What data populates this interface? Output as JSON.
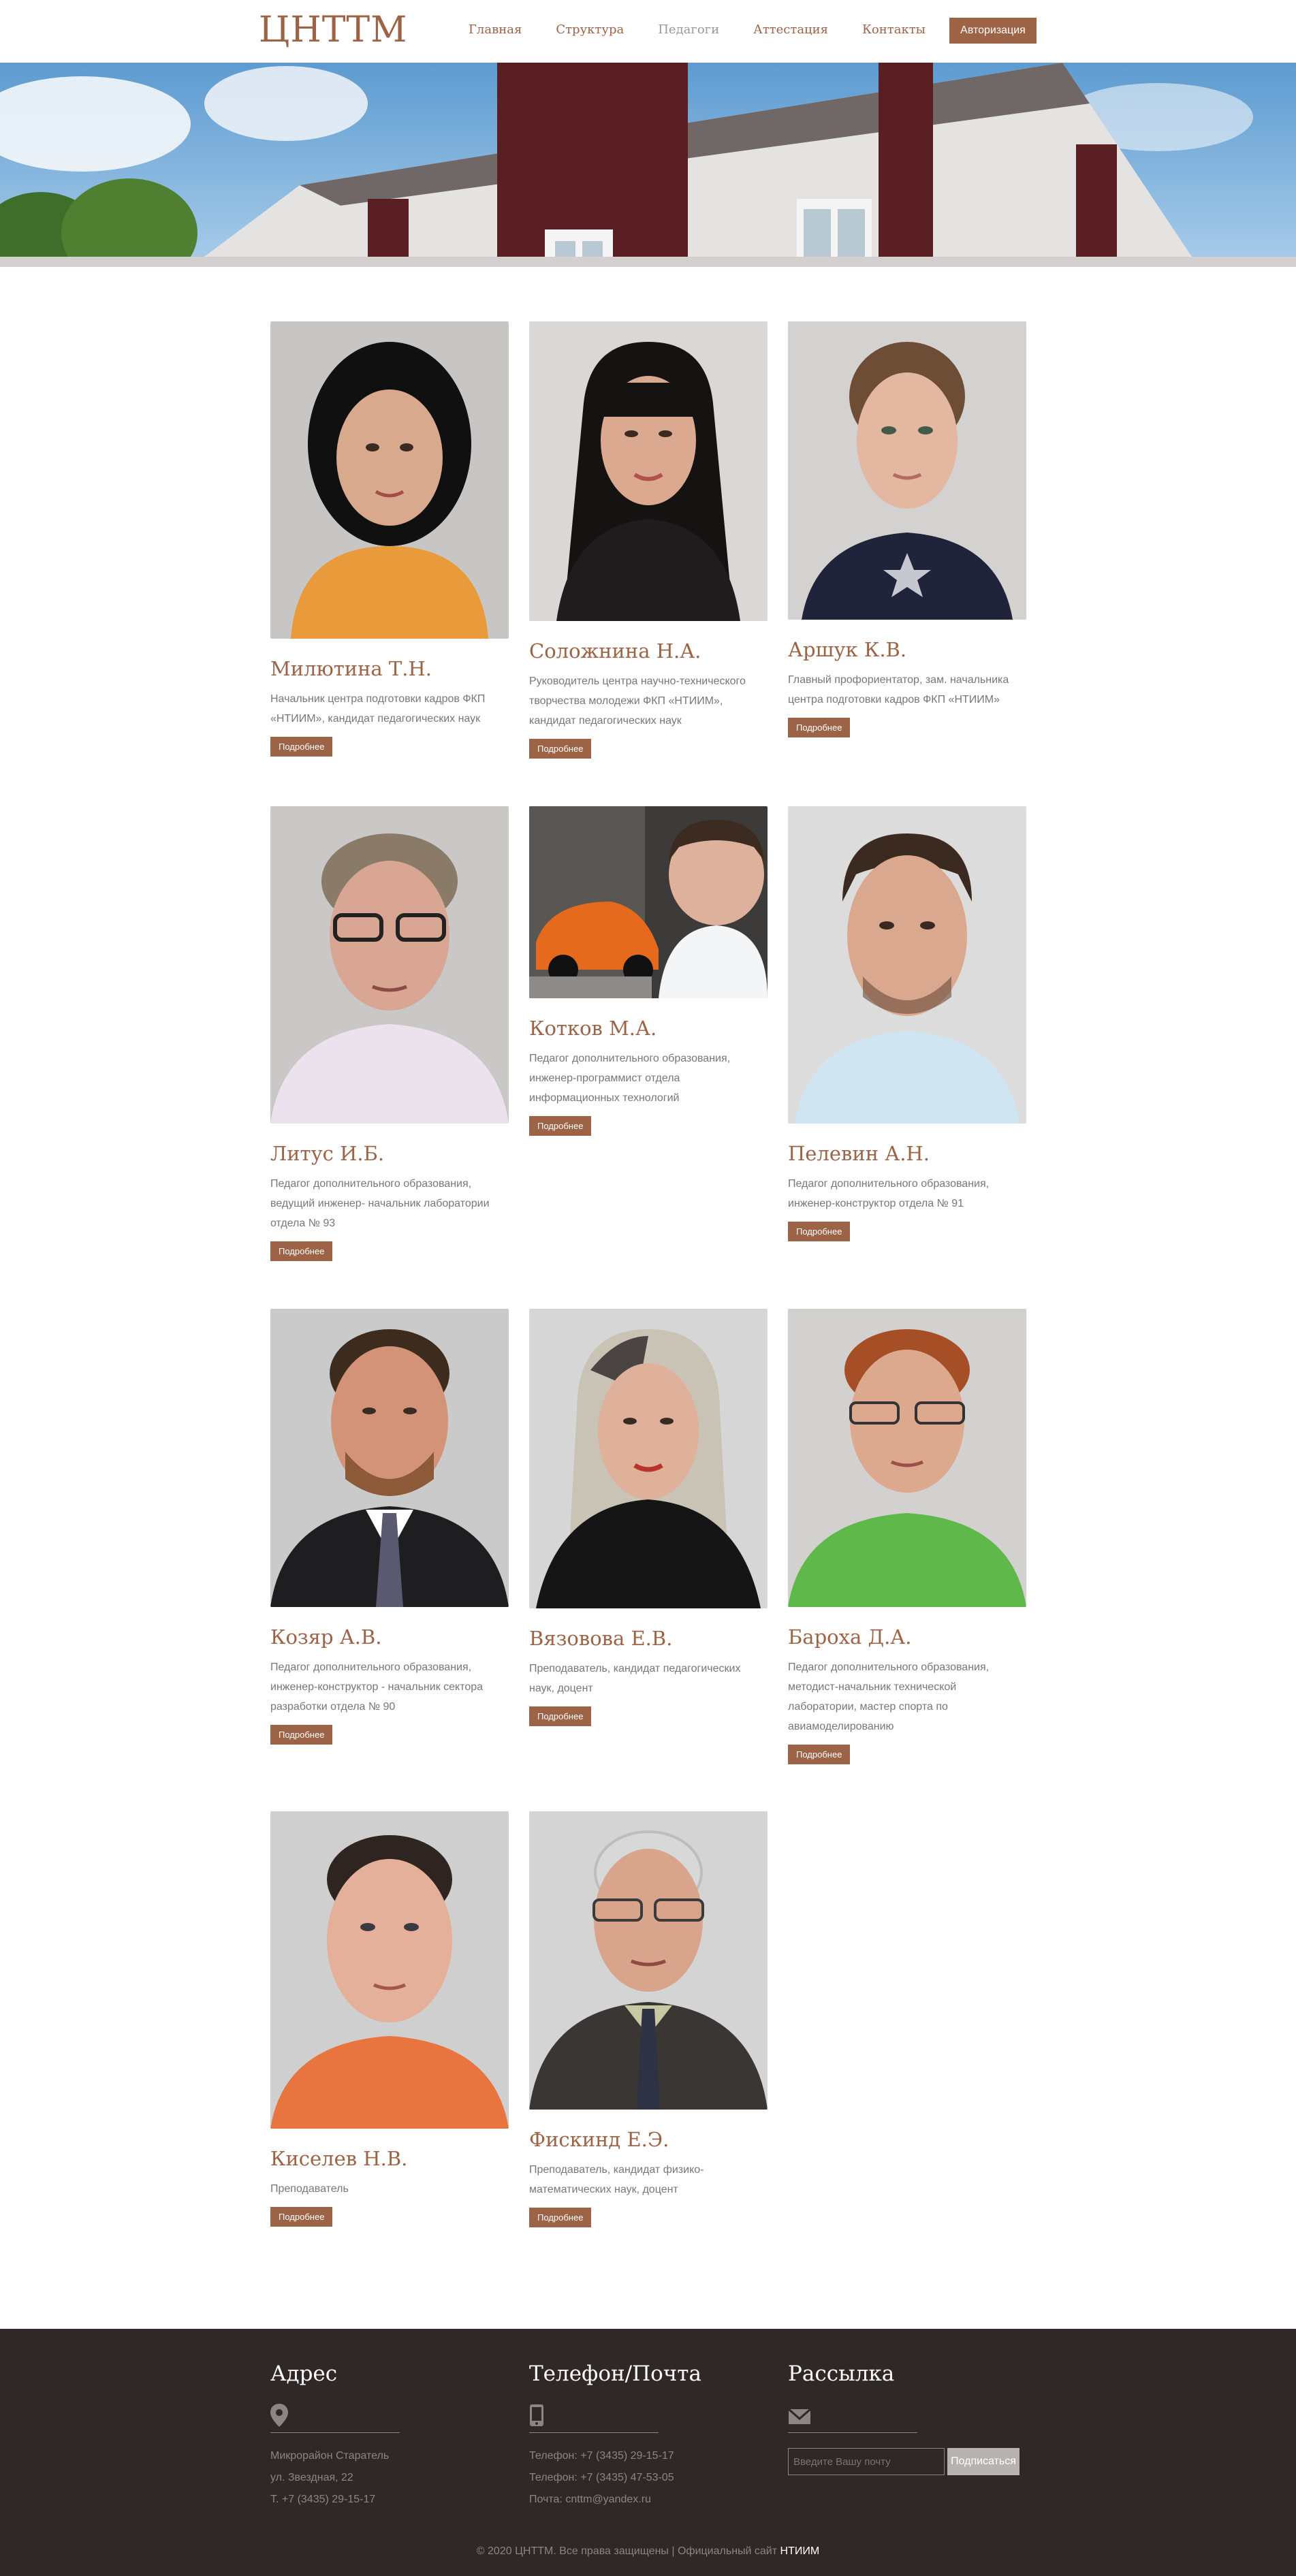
{
  "header": {
    "logo": "ЦНТТМ",
    "nav": [
      "Главная",
      "Структура",
      "Педагоги",
      "Аттестация",
      "Контакты"
    ],
    "auth_label": "Авторизация"
  },
  "more_label": "Подробнее",
  "staff": [
    {
      "name": "Милютина Т.Н.",
      "desc": "Начальник центра подготовки кадров ФКП «НТИИМ», кандидат педагогических наук"
    },
    {
      "name": "Соложнина Н.А.",
      "desc": "Руководитель центра научно-технического творчества молодежи ФКП «НТИИМ», кандидат педагогических наук"
    },
    {
      "name": "Аршук К.В.",
      "desc": "Главный профориентатор, зам. начальника центра подготовки кадров ФКП «НТИИМ»"
    },
    {
      "name": "Литус И.Б.",
      "desc": "Педагог дополнительного образования, ведущий инженер- начальник лаборатории отдела № 93"
    },
    {
      "name": "Котков М.А.",
      "desc": "Педагог дополнительного образования, инженер-программист отдела информационных технологий"
    },
    {
      "name": "Пелевин А.Н.",
      "desc": "Педагог дополнительного образования, инженер-конструктор отдела № 91"
    },
    {
      "name": "Козяр А.В.",
      "desc": "Педагог дополнительного образования, инженер-конструктор - начальник сектора разработки отдела № 90"
    },
    {
      "name": "Вязовова Е.В.",
      "desc": "Преподаватель, кандидат педагогических наук, доцент"
    },
    {
      "name": "Бароха Д.А.",
      "desc": "Педагог дополнительного образования, методист-начальник технической лаборатории, мастер спорта по авиамоделированию"
    },
    {
      "name": "Киселев Н.В.",
      "desc": "Преподаватель"
    },
    {
      "name": "Фискинд Е.Э.",
      "desc": "Преподаватель, кандидат физико-математических наук, доцент"
    }
  ],
  "footer": {
    "address_title": "Адрес",
    "address_lines": [
      "Микрорайон Старатель",
      "ул. Звездная, 22",
      "Т. +7 (3435) 29-15-17"
    ],
    "contact_title": "Телефон/Почта",
    "contact_lines": [
      "Телефон: +7 (3435) 29-15-17",
      "Телефон: +7 (3435) 47-53-05",
      "Почта: cnttm@yandex.ru"
    ],
    "newsletter_title": "Рассылка",
    "email_placeholder": "Введите Вашу почту",
    "subscribe_label": "Подписаться",
    "copyright": "© 2020 ЦНТТМ. Все права защищены | Официальный сайт",
    "site_link": "НТИИМ"
  },
  "colors": {
    "accent": "#9c6347",
    "footer_bg": "#2f2827",
    "muted": "#8d8584"
  }
}
